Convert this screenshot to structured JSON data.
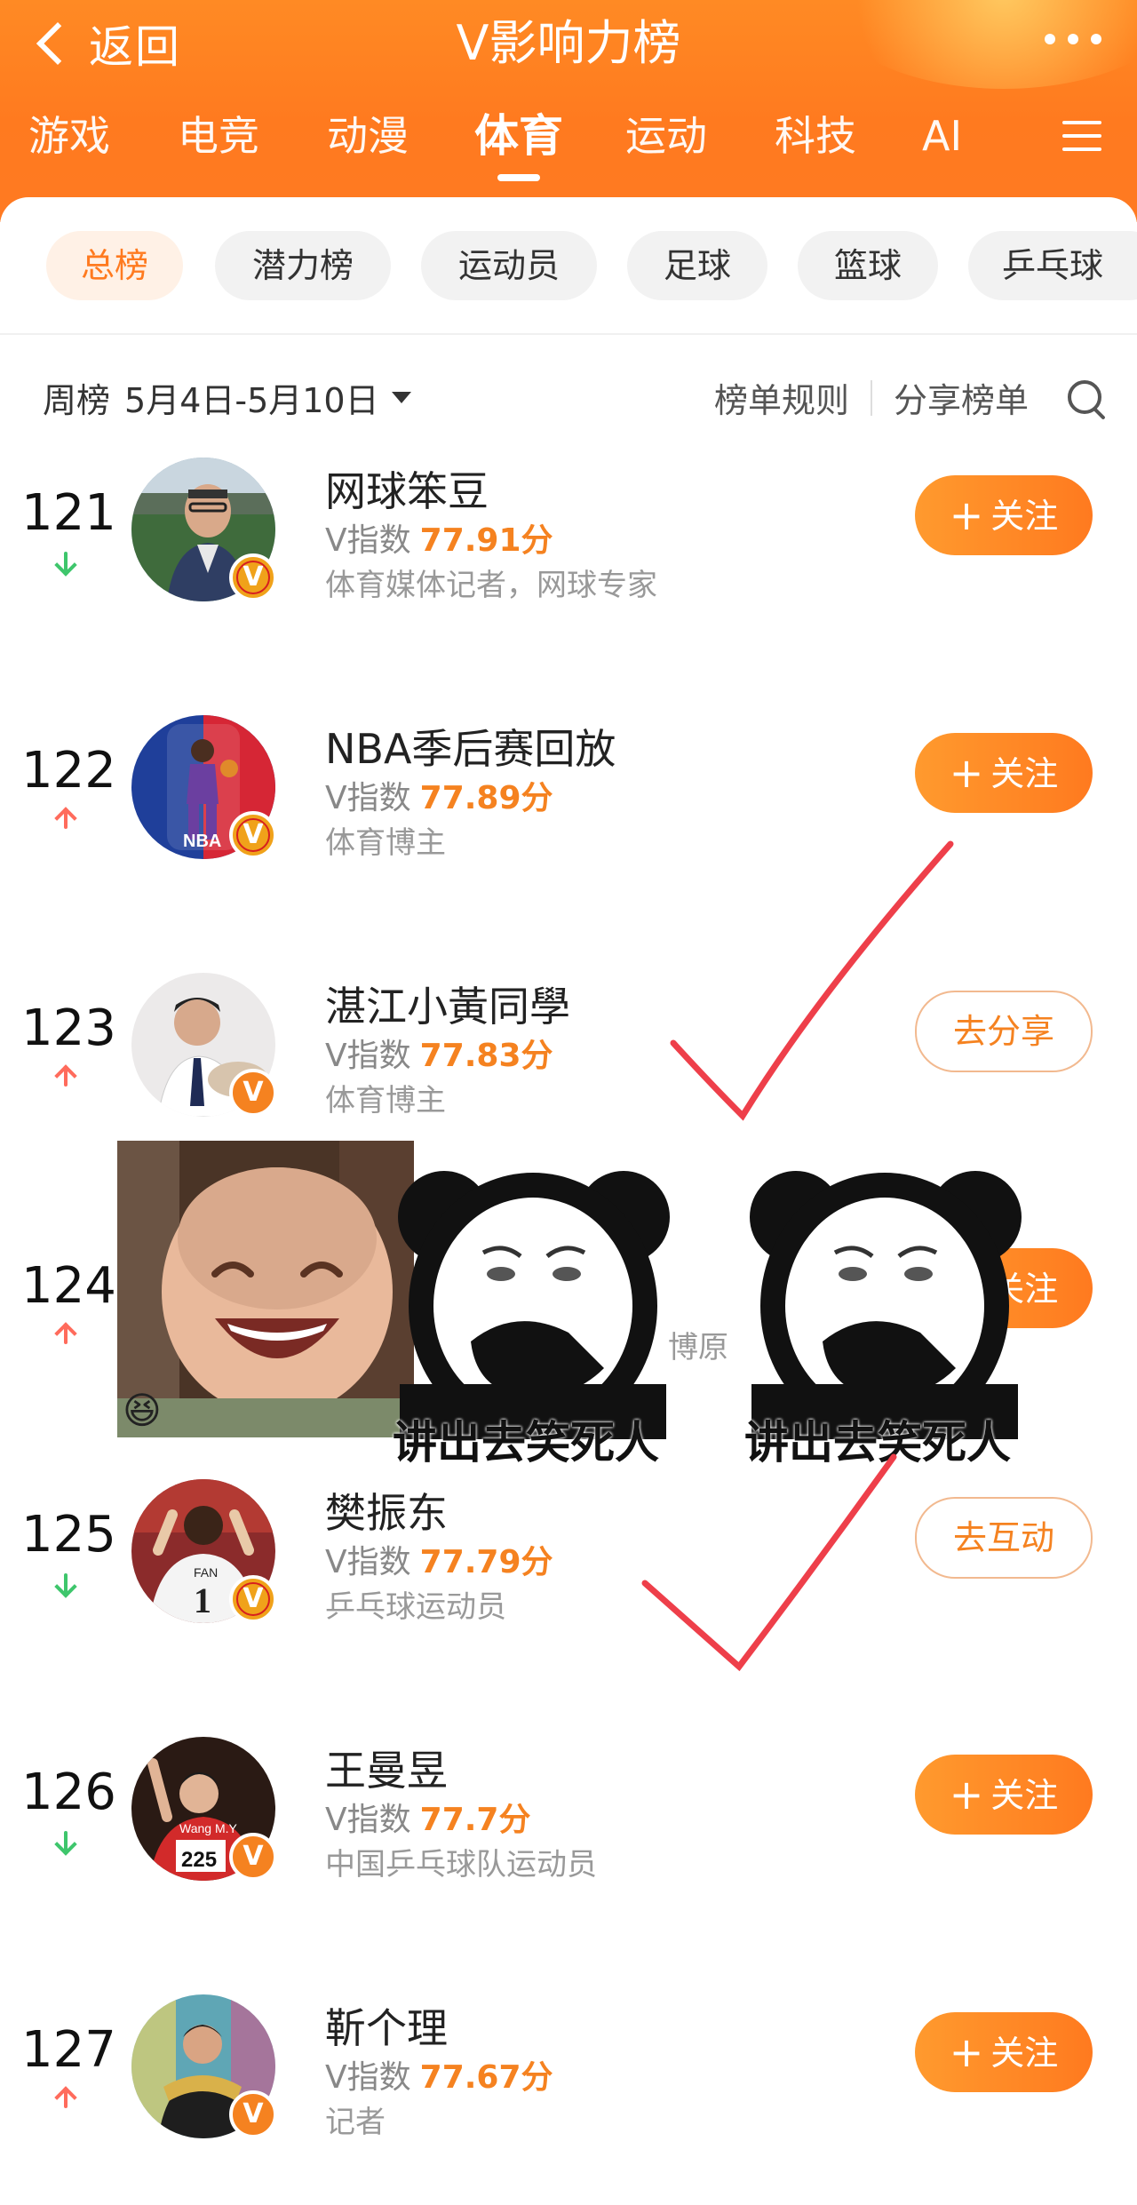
{
  "header": {
    "back_label": "返回",
    "title": "V影响力榜",
    "categories": [
      "游戏",
      "电竞",
      "动漫",
      "体育",
      "运动",
      "科技",
      "AI"
    ],
    "active_category": "体育"
  },
  "sub_tabs": [
    "总榜",
    "潜力榜",
    "运动员",
    "足球",
    "篮球",
    "乒乓球"
  ],
  "toolbar": {
    "week_label": "周榜",
    "date_range": "5月4日-5月10日",
    "rules_label": "榜单规则",
    "share_label": "分享榜单"
  },
  "v_index_label": "V指数",
  "rows": [
    {
      "rank": "121",
      "trend": "down",
      "name": "网球笨豆",
      "score": "77.91分",
      "desc": "体育媒体记者，网球专家",
      "button": "关注",
      "button_style": "follow"
    },
    {
      "rank": "122",
      "trend": "up",
      "name": "NBA季后赛回放",
      "score": "77.89分",
      "desc": "体育博主",
      "button": "关注",
      "button_style": "follow"
    },
    {
      "rank": "123",
      "trend": "up",
      "name": "湛江小黃同學",
      "score": "77.83分",
      "desc": "体育博主",
      "button": "去分享",
      "button_style": "outline"
    },
    {
      "rank": "124",
      "trend": "up",
      "name": "",
      "score": "",
      "desc": "博原",
      "button": "关注",
      "button_style": "follow"
    },
    {
      "rank": "125",
      "trend": "down",
      "name": "樊振东",
      "score": "77.79分",
      "desc": "乒乓球运动员",
      "button": "去互动",
      "button_style": "outline"
    },
    {
      "rank": "126",
      "trend": "down",
      "name": "王曼昱",
      "score": "77.7分",
      "desc": "中国乒乓球队运动员",
      "button": "关注",
      "button_style": "follow"
    },
    {
      "rank": "127",
      "trend": "up",
      "name": "靳个理",
      "score": "77.67分",
      "desc": "记者",
      "button": "关注",
      "button_style": "follow"
    }
  ],
  "overlay": {
    "meme_caption_1": "讲出去笑死人",
    "meme_caption_2": "讲出去笑死人",
    "emoji": "😆"
  }
}
